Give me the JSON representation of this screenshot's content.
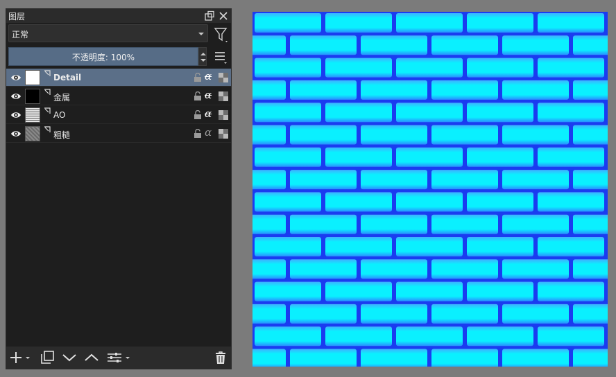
{
  "panel": {
    "title": "图层",
    "blend_mode": "正常",
    "opacity_label": "不透明度:  100%"
  },
  "layers": [
    {
      "name": "Detail",
      "selected": true,
      "thumb": "white"
    },
    {
      "name": "金属",
      "selected": false,
      "thumb": "black"
    },
    {
      "name": "AO",
      "selected": false,
      "thumb": "noise-light"
    },
    {
      "name": "粗糙",
      "selected": false,
      "thumb": "noise-gray"
    }
  ],
  "alpha_glyph": "α",
  "colors": {
    "panel_bg": "#1e1e1e",
    "selected_row": "#5b6f88",
    "opacity_bar": "#566c86",
    "brick_face": "#0af0ff",
    "brick_mortar": "#1a3cf0"
  },
  "bottom_toolbar": [
    "add-layer-icon",
    "duplicate-layer-icon",
    "move-down-icon",
    "move-up-icon",
    "properties-icon",
    "delete-icon"
  ]
}
